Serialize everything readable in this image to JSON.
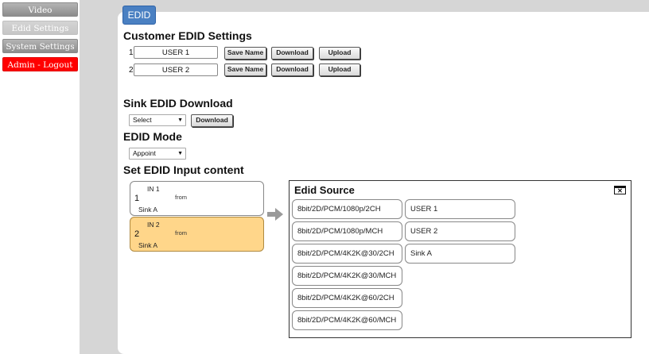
{
  "nav": {
    "video": "Video",
    "edid_settings": "Edid Settings",
    "system_settings": "System Settings",
    "logout": "Admin - Logout"
  },
  "tab": "EDID",
  "customer": {
    "title": "Customer EDID Settings",
    "rows": [
      {
        "index": "1",
        "name": "USER 1"
      },
      {
        "index": "2",
        "name": "USER 2"
      }
    ],
    "save_label": "Save Name",
    "download_label": "Download",
    "upload_label": "Upload"
  },
  "sink": {
    "title": "Sink EDID Download",
    "select_value": "Select",
    "download_label": "Download"
  },
  "mode": {
    "title": "EDID Mode",
    "select_value": "Appoint"
  },
  "input_content": {
    "title": "Set EDID Input content",
    "inputs": [
      {
        "label": "IN 1",
        "num": "1",
        "from": "from",
        "source": "Sink A",
        "selected": false
      },
      {
        "label": "IN 2",
        "num": "2",
        "from": "from",
        "source": "Sink A",
        "selected": true
      }
    ]
  },
  "edid_source": {
    "title": "Edid Source",
    "presets": [
      "8bit/2D/PCM/1080p/2CH",
      "8bit/2D/PCM/1080p/MCH",
      "8bit/2D/PCM/4K2K@30/2CH",
      "8bit/2D/PCM/4K2K@30/MCH",
      "8bit/2D/PCM/4K2K@60/2CH",
      "8bit/2D/PCM/4K2K@60/MCH"
    ],
    "custom": [
      "USER 1",
      "USER 2",
      "Sink A"
    ]
  },
  "colors": {
    "accent": "#4a80c2",
    "logout": "#ff0000",
    "selected_card": "#ffd68a"
  }
}
